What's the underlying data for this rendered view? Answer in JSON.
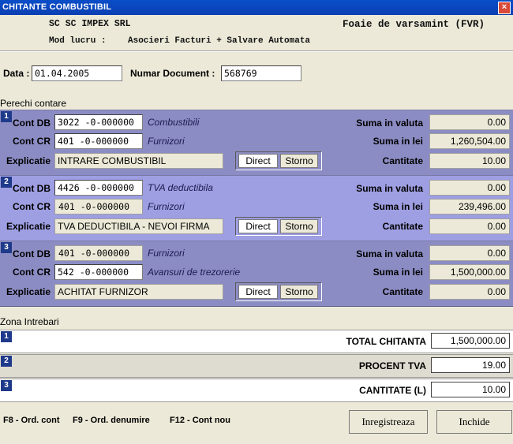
{
  "window": {
    "title": "CHITANTE COMBUSTIBIL",
    "close_glyph": "×"
  },
  "header": {
    "company": "SC SC IMPEX SRL",
    "doc_type": "Foaie de varsamint (FVR)",
    "mode_label": "Mod lucru :",
    "mode_value": "Asocieri Facturi + Salvare Automata"
  },
  "form": {
    "date_label": "Data :",
    "date_value": "01.04.2005",
    "docnum_label": "Numar Document :",
    "docnum_value": "568769"
  },
  "pairs_section_label": "Perechi contare",
  "labels": {
    "cont_db": "Cont DB",
    "cont_cr": "Cont CR",
    "explicatie": "Explicatie",
    "suma_valuta": "Suma in valuta",
    "suma_lei": "Suma in lei",
    "cantitate": "Cantitate",
    "direct": "Direct",
    "storno": "Storno"
  },
  "pairs": [
    {
      "number": "1",
      "db_account": "3022 -0-000000",
      "db_name": "Combustibili",
      "cr_account": "401  -0-000000",
      "cr_name": "Furnizori",
      "explanation": "INTRARE COMBUSTIBIL",
      "suma_valuta": "0.00",
      "suma_lei": "1,260,504.00",
      "cantitate": "10.00"
    },
    {
      "number": "2",
      "db_account": "4426 -0-000000",
      "db_name": "TVA deductibila",
      "cr_account": "401  -0-000000",
      "cr_name": "Furnizori",
      "explanation": "TVA DEDUCTIBILA - NEVOI FIRMA",
      "suma_valuta": "0.00",
      "suma_lei": "239,496.00",
      "cantitate": "0.00"
    },
    {
      "number": "3",
      "db_account": "401  -0-000000",
      "db_name": "Furnizori",
      "cr_account": "542  -0-000000",
      "cr_name": "Avansuri de trezorerie",
      "explanation": "ACHITAT FURNIZOR",
      "suma_valuta": "0.00",
      "suma_lei": "1,500,000.00",
      "cantitate": "0.00"
    }
  ],
  "questions_section_label": "Zona Intrebari",
  "totals": [
    {
      "number": "1",
      "label": "TOTAL CHITANTA",
      "value": "1,500,000.00"
    },
    {
      "number": "2",
      "label": "PROCENT TVA",
      "value": "19.00"
    },
    {
      "number": "3",
      "label": "CANTITATE (L)",
      "value": "10.00"
    }
  ],
  "footer": {
    "f8": "F8 - Ord. cont",
    "f9": "F9 - Ord. denumire",
    "f12": "F12 - Cont nou",
    "save": "Inregistreaza",
    "close": "Inchide"
  },
  "colors": {
    "panel_1": "#8c8cc4",
    "panel_2": "#9e9ee2",
    "panel_3": "#8c8cc4",
    "titlebar": "#0a4ec8",
    "number_badge": "#1f3a8a"
  }
}
